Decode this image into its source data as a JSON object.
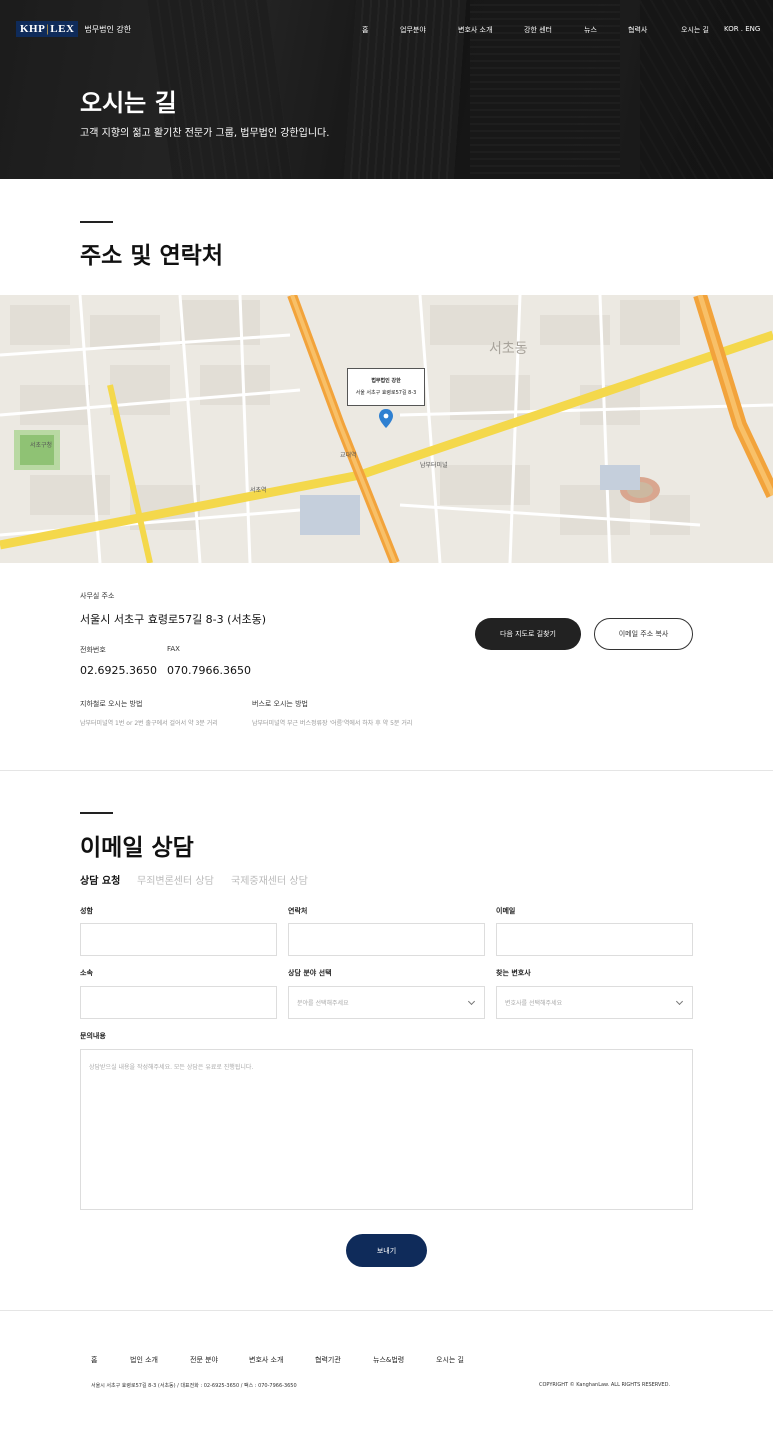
{
  "header": {
    "logo_mark_left": "KHP",
    "logo_mark_right": "LEX",
    "logo_text": "법무법인 강한",
    "nav": [
      "홈",
      "업무분야",
      "변호사 소개",
      "강한 센터",
      "뉴스",
      "협력사",
      "오시는 길",
      "KOR . ENG"
    ]
  },
  "hero": {
    "title": "오시는 길",
    "subtitle": "고객 지향의 젊고 활기찬 전문가 그룹, 법무법인 강한입니다."
  },
  "contact_section": {
    "title": "주소 및 연락처"
  },
  "map": {
    "popup_title": "법무법인 강한",
    "popup_address": "서울 서초구 효령로57길 8-3",
    "labels": [
      "서초동",
      "서초역",
      "교대역",
      "남부터미널",
      "서초구청"
    ]
  },
  "contact": {
    "address_label": "사무실 주소",
    "address": "서울시 서초구 효령로57길 8-3 (서초동)",
    "phone_label": "전화번호",
    "phone": "02.6925.3650",
    "fax_label": "FAX",
    "fax": "070.7966.3650",
    "subway_label": "지하철로 오시는 방법",
    "subway_desc": "남부터미널역 1번 or 2번 출구에서 걸어서 약 3분 거리",
    "bus_label": "버스로 오시는 방법",
    "bus_desc": "남부터미널역 부근 버스정류장 '어름'역에서 하차 후 약 5분 거리",
    "map_button": "다음 지도로 길찾기",
    "email_button": "이메일 주소 복사"
  },
  "email_section": {
    "title": "이메일 상담",
    "tabs": [
      "상담 요청",
      "무죄변론센터 상담",
      "국제중재센터 상담"
    ]
  },
  "form": {
    "name_label": "성함",
    "contact_label": "연락처",
    "email_label": "이메일",
    "affiliation_label": "소속",
    "field_label": "상담 분야 선택",
    "field_placeholder": "분야를 선택해주세요",
    "lawyer_label": "찾는 변호사",
    "lawyer_placeholder": "변호사를 선택해주세요",
    "message_label": "문의내용",
    "message_placeholder": "상담받으실 내용을 작성해주세요. 모든 상담은 유료로 진행됩니다.",
    "submit": "보내기"
  },
  "footer": {
    "links": [
      "홈",
      "법인 소개",
      "전문 분야",
      "변호사 소개",
      "협력기관",
      "뉴스&법령",
      "오시는 길"
    ],
    "info": "서울시 서초구 효령로57길 8-3 (서초동) / 대표전화 : 02-6925-3650 / 팩스 : 070-7966-3650",
    "copyright": "COPYRIGHT © KanghanLaw. ALL RIGHTS RESERVED."
  },
  "colors": {
    "brand_navy": "#0f2b5a",
    "dark": "#222222",
    "road_yellow": "#f4d84b",
    "road_orange": "#f2a33b"
  }
}
